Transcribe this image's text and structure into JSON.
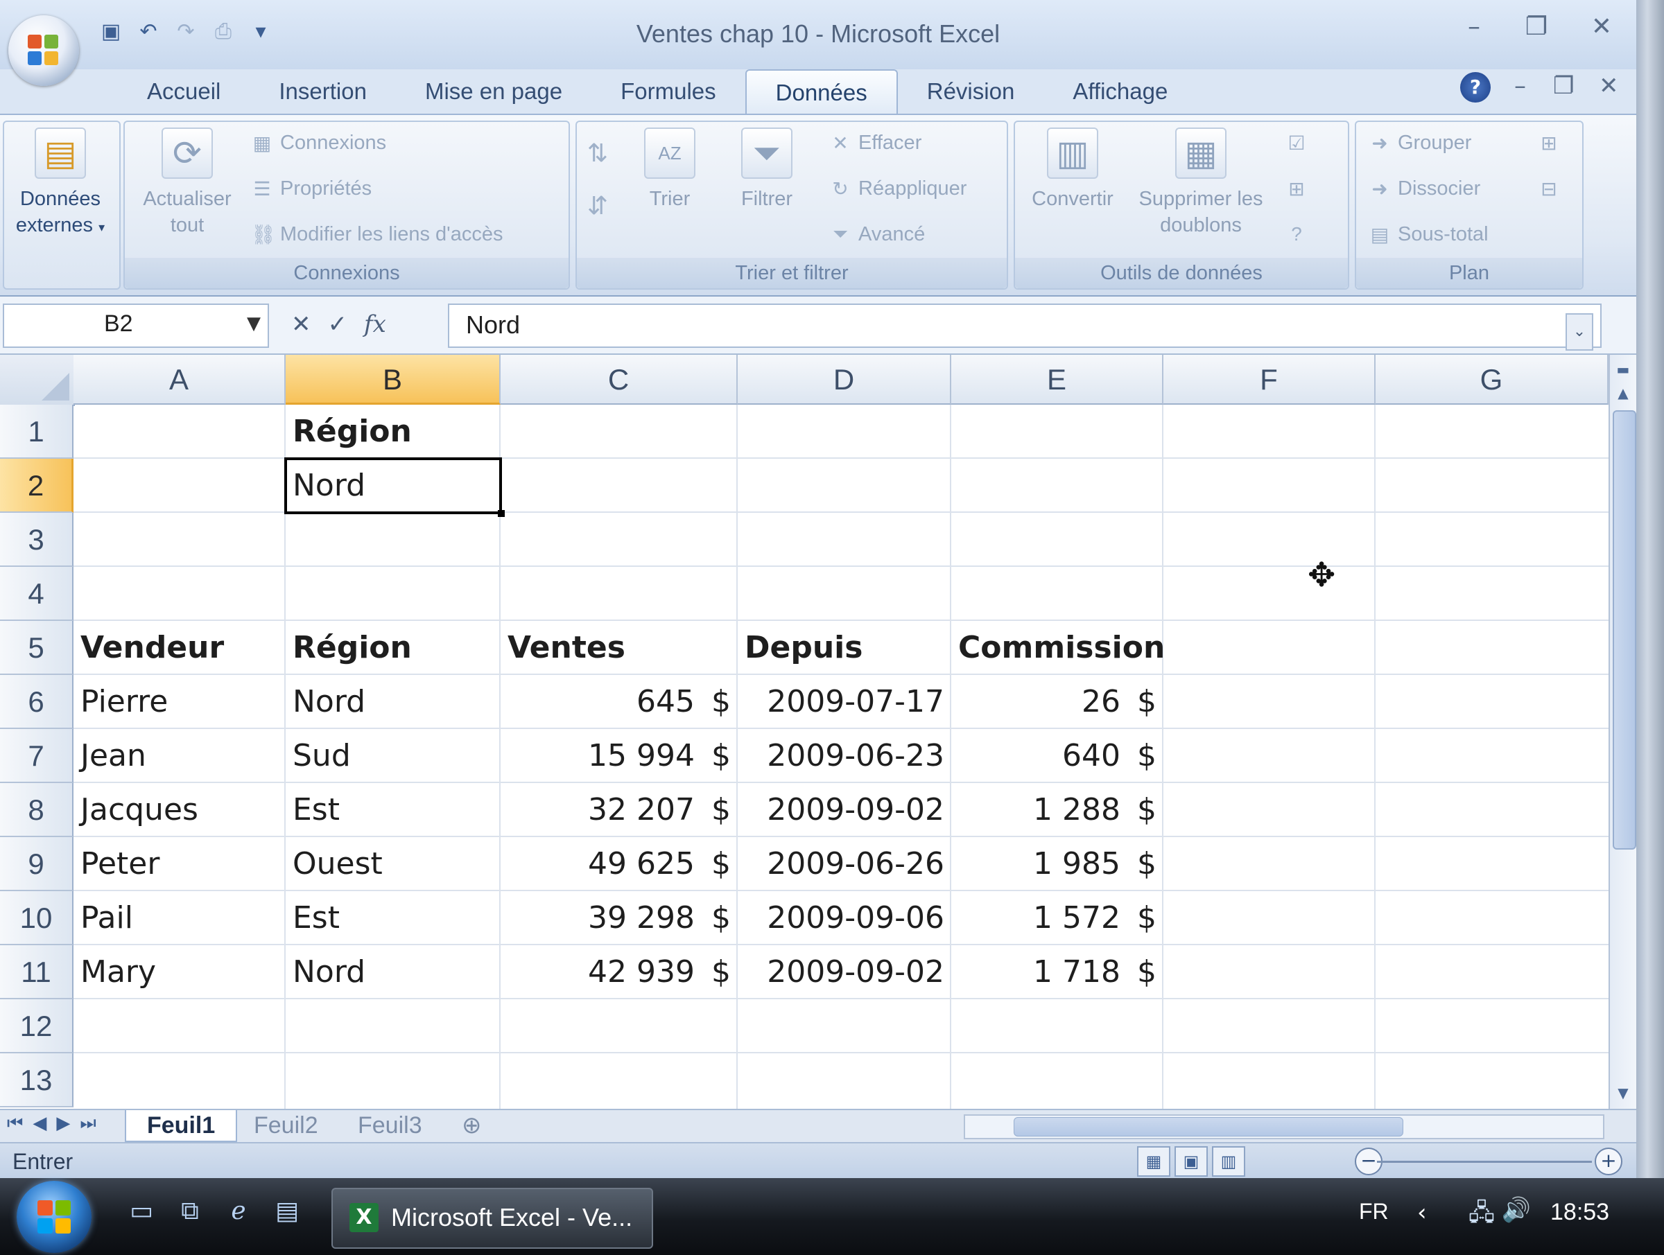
{
  "window": {
    "title": "Ventes chap 10 - Microsoft Excel"
  },
  "quick_access": {
    "icons": [
      "save-icon",
      "undo-icon",
      "redo-icon",
      "print-preview-icon",
      "customize-icon"
    ]
  },
  "tabs": [
    {
      "label": "Accueil"
    },
    {
      "label": "Insertion"
    },
    {
      "label": "Mise en page"
    },
    {
      "label": "Formules"
    },
    {
      "label": "Données",
      "active": true
    },
    {
      "label": "Révision"
    },
    {
      "label": "Affichage"
    }
  ],
  "ribbon": {
    "external_data": {
      "label": "Données externes",
      "arrow": "▾"
    },
    "connexions": {
      "group_label": "Connexions",
      "refresh_label": "Actualiser tout",
      "connexions_label": "Connexions",
      "properties_label": "Propriétés",
      "edit_links_label": "Modifier les liens d'accès"
    },
    "sort_filter": {
      "group_label": "Trier et filtrer",
      "sort_label": "Trier",
      "filter_label": "Filtrer",
      "clear_label": "Effacer",
      "reapply_label": "Réappliquer",
      "advanced_label": "Avancé"
    },
    "data_tools": {
      "group_label": "Outils de données",
      "convert_label": "Convertir",
      "remove_dupes_label": "Supprimer les doublons"
    },
    "outline": {
      "group_label": "Plan",
      "group_btn": "Grouper",
      "ungroup_btn": "Dissocier",
      "subtotal_btn": "Sous-total"
    }
  },
  "formula_bar": {
    "name_box": "B2",
    "value": "Nord"
  },
  "columns": [
    "A",
    "B",
    "C",
    "D",
    "E",
    "F",
    "G"
  ],
  "rows": [
    "1",
    "2",
    "3",
    "4",
    "5",
    "6",
    "7",
    "8",
    "9",
    "10",
    "11",
    "12",
    "13"
  ],
  "selection": {
    "column": "B",
    "row": "2"
  },
  "sheet": {
    "criteria_header": "Région",
    "criteria_value": "Nord",
    "headers": [
      "Vendeur",
      "Région",
      "Ventes",
      "Depuis",
      "Commission"
    ],
    "currency": "$",
    "records": [
      {
        "vendeur": "Pierre",
        "region": "Nord",
        "ventes": "645",
        "depuis": "2009-07-17",
        "commission": "26"
      },
      {
        "vendeur": "Jean",
        "region": "Sud",
        "ventes": "15 994",
        "depuis": "2009-06-23",
        "commission": "640"
      },
      {
        "vendeur": "Jacques",
        "region": "Est",
        "ventes": "32 207",
        "depuis": "2009-09-02",
        "commission": "1 288"
      },
      {
        "vendeur": "Peter",
        "region": "Ouest",
        "ventes": "49 625",
        "depuis": "2009-06-26",
        "commission": "1 985"
      },
      {
        "vendeur": "Pail",
        "region": "Est",
        "ventes": "39 298",
        "depuis": "2009-09-06",
        "commission": "1 572"
      },
      {
        "vendeur": "Mary",
        "region": "Nord",
        "ventes": "42 939",
        "depuis": "2009-09-02",
        "commission": "1 718"
      }
    ]
  },
  "sheet_tabs": [
    {
      "label": "Feuil1",
      "active": true
    },
    {
      "label": "Feuil2"
    },
    {
      "label": "Feuil3"
    }
  ],
  "status": {
    "mode": "Entrer"
  },
  "taskbar": {
    "task_label": "Microsoft Excel - Ve...",
    "language": "FR",
    "clock": "18:53"
  },
  "colors": {
    "selection_header": "#f7c25a",
    "ribbon_text": "#2d4b78",
    "grid_line": "#dbe2ec"
  }
}
